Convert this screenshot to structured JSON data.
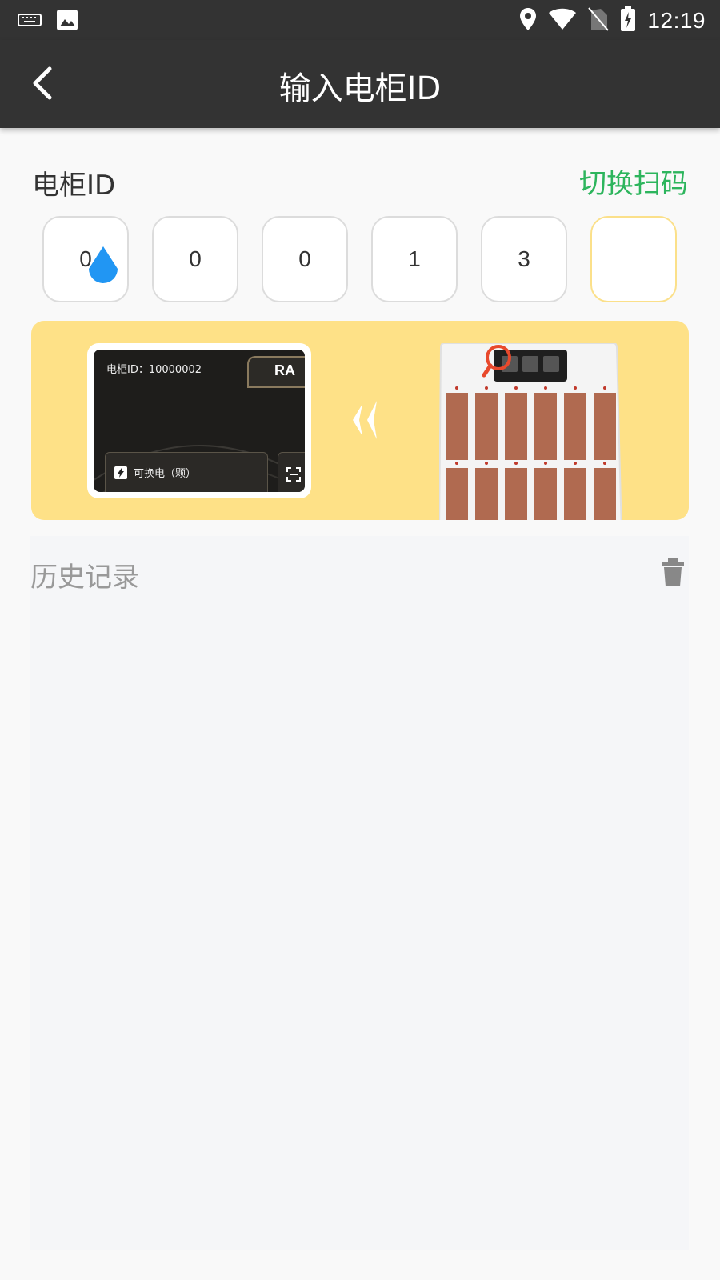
{
  "status_bar": {
    "time": "12:19",
    "left_icons": [
      "keyboard-icon",
      "image-icon"
    ],
    "right_icons": [
      "location-icon",
      "wifi-icon",
      "no-sim-icon",
      "battery-charging-icon"
    ]
  },
  "app_bar": {
    "title": "输入电柜ID",
    "back_icon": "back-arrow-icon"
  },
  "cabinet_id_section": {
    "title": "电柜ID",
    "switch_label": "切换扫码",
    "digits": [
      "0",
      "0",
      "0",
      "1",
      "3",
      ""
    ]
  },
  "banner": {
    "phone_id_text": "电柜ID：10000002",
    "phone_brand_text": "RA",
    "phone_card_label": "可换电（颗）"
  },
  "history": {
    "title": "历史记录",
    "clear_icon": "trash-icon"
  },
  "colors": {
    "bar_background": "#333333",
    "accent_green": "#2db55d",
    "banner_yellow": "#fee187",
    "active_box_border": "#fbe08a",
    "cursor_blue": "#2196f3",
    "battery_slot": "#b06a50"
  }
}
